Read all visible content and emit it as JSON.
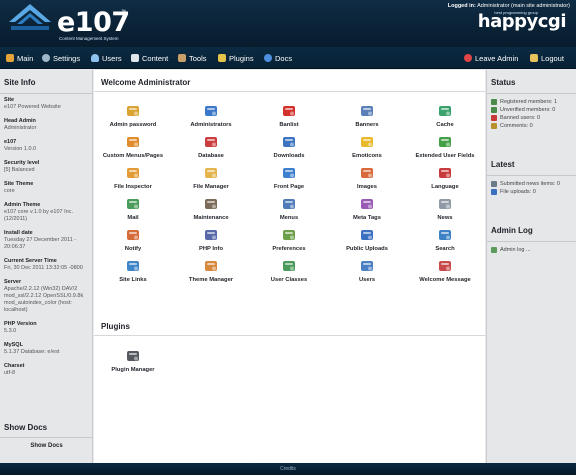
{
  "header": {
    "logo_text": "e107",
    "logo_tagline": "Content Management System",
    "logged_in_label": "Logged in:",
    "logged_in_user": "Administrator (main site administrator)",
    "brand": "happycgi",
    "brand_tagline": "best programming group"
  },
  "nav": {
    "main": "Main",
    "settings": "Settings",
    "users": "Users",
    "content": "Content",
    "tools": "Tools",
    "plugins": "Plugins",
    "docs": "Docs",
    "leave_admin": "Leave Admin",
    "logout": "Logout"
  },
  "site_info": {
    "title": "Site Info",
    "items": [
      {
        "label": "Site",
        "value": "e107 Powered Website"
      },
      {
        "label": "Head Admin",
        "value": "Administrator"
      },
      {
        "label": "e107",
        "value": "Version 1.0.0"
      },
      {
        "label": "Security level",
        "value": "[5] Balanced"
      },
      {
        "label": "Site Theme",
        "value": "core"
      },
      {
        "label": "Admin Theme",
        "value": "e107 core v.1.0 by e107 Inc. (12/2011)"
      },
      {
        "label": "Install date",
        "value": "Tuesday 27 December 2011 - 20:06:37"
      },
      {
        "label": "Current Server Time",
        "value": "Fri, 30 Dec 2011 13:32:05 -0800"
      },
      {
        "label": "Server",
        "value": "Apache/2.2.12 (Win32) DAV/2 mod_ssl/2.2.12 OpenSSL/0.9.8k mod_autoindex_color (host: localhost)"
      },
      {
        "label": "PHP Version",
        "value": "5.3.0"
      },
      {
        "label": "MySQL",
        "value": "5.1.37 Database: e/est"
      },
      {
        "label": "Charset",
        "value": "utf-8"
      }
    ],
    "show_docs_title": "Show Docs",
    "show_docs_link": "Show Docs"
  },
  "main": {
    "welcome_title": "Welcome Administrator",
    "items": [
      {
        "label": "Admin password",
        "icon": "key-user-icon",
        "color": "#d9a431"
      },
      {
        "label": "Administrators",
        "icon": "admin-user-icon",
        "color": "#3b78c9"
      },
      {
        "label": "Banlist",
        "icon": "red-x-icon",
        "color": "#d2312b"
      },
      {
        "label": "Banners",
        "icon": "monitor-icon",
        "color": "#5b7fb8"
      },
      {
        "label": "Cache",
        "icon": "cache-icon",
        "color": "#3aa36b"
      },
      {
        "label": "Custom Menus/Pages",
        "icon": "pages-icon",
        "color": "#e08b2c"
      },
      {
        "label": "Database",
        "icon": "database-icon",
        "color": "#cc3d3d"
      },
      {
        "label": "Downloads",
        "icon": "download-arrow-icon",
        "color": "#3d74c2"
      },
      {
        "label": "Emoticons",
        "icon": "smiley-icon",
        "color": "#e7b92b"
      },
      {
        "label": "Extended User Fields",
        "icon": "user-plus-icon",
        "color": "#43a047"
      },
      {
        "label": "File Inspector",
        "icon": "magnifier-file-icon",
        "color": "#e39b35"
      },
      {
        "label": "File Manager",
        "icon": "folder-icon",
        "color": "#e3b54c"
      },
      {
        "label": "Front Page",
        "icon": "front-page-icon",
        "color": "#3f7fd0"
      },
      {
        "label": "Images",
        "icon": "images-icon",
        "color": "#d9683a"
      },
      {
        "label": "Language",
        "icon": "flags-icon",
        "color": "#c93b3b"
      },
      {
        "label": "Mail",
        "icon": "mail-icon",
        "color": "#4b9b5a"
      },
      {
        "label": "Maintenance",
        "icon": "hammer-icon",
        "color": "#7c6a5a"
      },
      {
        "label": "Menus",
        "icon": "menus-icon",
        "color": "#4f7cb9"
      },
      {
        "label": "Meta Tags",
        "icon": "meta-tags-icon",
        "color": "#9a5bb5"
      },
      {
        "label": "News",
        "icon": "news-icon",
        "color": "#8f9aa6"
      },
      {
        "label": "Notify",
        "icon": "notify-icon",
        "color": "#d66b3a"
      },
      {
        "label": "PHP Info",
        "icon": "php-info-icon",
        "color": "#5868a8"
      },
      {
        "label": "Preferences",
        "icon": "preferences-icon",
        "color": "#6ea04a"
      },
      {
        "label": "Public Uploads",
        "icon": "upload-icon",
        "color": "#3b6fc0"
      },
      {
        "label": "Search",
        "icon": "search-icon",
        "color": "#3d82c4"
      },
      {
        "label": "Site Links",
        "icon": "site-links-icon",
        "color": "#3f86c8"
      },
      {
        "label": "Theme Manager",
        "icon": "theme-icon",
        "color": "#d7883d"
      },
      {
        "label": "User Classes",
        "icon": "user-classes-icon",
        "color": "#4a9a5c"
      },
      {
        "label": "Users",
        "icon": "users-icon",
        "color": "#4a7fc2"
      },
      {
        "label": "Welcome Message",
        "icon": "welcome-message-icon",
        "color": "#c84a4a"
      }
    ],
    "plugins_title": "Plugins",
    "plugins": [
      {
        "label": "Plugin Manager",
        "icon": "plugin-manager-icon",
        "color": "#555a60"
      }
    ]
  },
  "status": {
    "title": "Status",
    "items": [
      {
        "text": "Registered members: 1",
        "icon": "member-icon",
        "color": "#4a8a4a"
      },
      {
        "text": "Unverified members: 0",
        "icon": "member-icon",
        "color": "#4a8a4a"
      },
      {
        "text": "Banned users: 0",
        "icon": "banned-icon",
        "color": "#c83a3a"
      },
      {
        "text": "Comments: 0",
        "icon": "comment-icon",
        "color": "#b88f2a"
      }
    ],
    "latest_title": "Latest",
    "latest_items": [
      {
        "text": "Submitted news items: 0",
        "icon": "news-small-icon",
        "color": "#6c7b8a"
      },
      {
        "text": "File uploads: 0",
        "icon": "upload-small-icon",
        "color": "#3b6fc0"
      }
    ],
    "admin_log_title": "Admin Log",
    "admin_log_link": "Admin log ..."
  },
  "footer": {
    "text": "Credits"
  }
}
